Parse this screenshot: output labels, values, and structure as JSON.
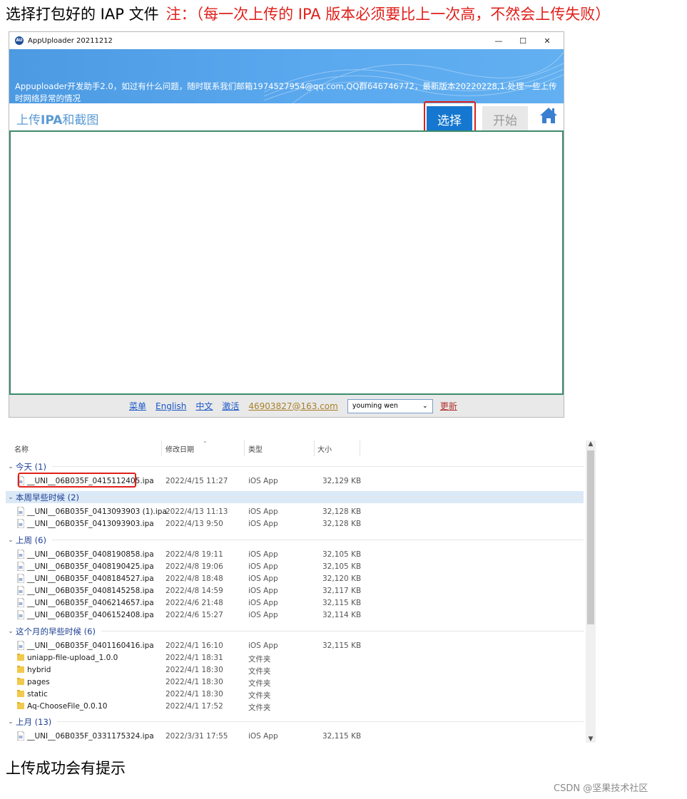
{
  "instruction": {
    "text": "选择打包好的 IAP 文件",
    "note": "注：（每一次上传的 IPA 版本必须要比上一次高，不然会上传失败）"
  },
  "window": {
    "title": "AppUploader 20211212",
    "icon_text": "AU",
    "controls": {
      "minimize": "—",
      "maximize": "☐",
      "close": "✕"
    },
    "banner_text": "Appuploader开发助手2.0，如过有什么问题，随时联系我们邮箱1974527954@qq.com,QQ群646746772，最新版本20220228,1.处理一些上传时网络异常的情况",
    "upload_title_prefix": "上传",
    "upload_title_bold": "IPA",
    "upload_title_suffix": "和截图",
    "select_button": "选择",
    "start_button": "开始",
    "footer": {
      "links": [
        "菜单",
        "English",
        "中文",
        "激活"
      ],
      "email": "46903827@163.com",
      "account_select": "youming wen",
      "update": "更新"
    }
  },
  "explorer": {
    "columns": {
      "name": "名称",
      "date": "修改日期",
      "type": "类型",
      "size": "大小"
    },
    "groups": [
      {
        "label": "今天 (1)",
        "rows": [
          {
            "name": "__UNI__06B035F_0415112405.ipa",
            "date": "2022/4/15 11:27",
            "type": "iOS App",
            "size": "32,129 KB",
            "icon": "file"
          }
        ]
      },
      {
        "label": "本周早些时候 (2)",
        "rows": [
          {
            "name": "__UNI__06B035F_0413093903 (1).ipa",
            "date": "2022/4/13 11:13",
            "type": "iOS App",
            "size": "32,128 KB",
            "icon": "file"
          },
          {
            "name": "__UNI__06B035F_0413093903.ipa",
            "date": "2022/4/13 9:50",
            "type": "iOS App",
            "size": "32,128 KB",
            "icon": "file"
          }
        ]
      },
      {
        "label": "上周 (6)",
        "rows": [
          {
            "name": "__UNI__06B035F_0408190858.ipa",
            "date": "2022/4/8 19:11",
            "type": "iOS App",
            "size": "32,105 KB",
            "icon": "file"
          },
          {
            "name": "__UNI__06B035F_0408190425.ipa",
            "date": "2022/4/8 19:06",
            "type": "iOS App",
            "size": "32,105 KB",
            "icon": "file"
          },
          {
            "name": "__UNI__06B035F_0408184527.ipa",
            "date": "2022/4/8 18:48",
            "type": "iOS App",
            "size": "32,120 KB",
            "icon": "file"
          },
          {
            "name": "__UNI__06B035F_0408145258.ipa",
            "date": "2022/4/8 14:59",
            "type": "iOS App",
            "size": "32,117 KB",
            "icon": "file"
          },
          {
            "name": "__UNI__06B035F_0406214657.ipa",
            "date": "2022/4/6 21:48",
            "type": "iOS App",
            "size": "32,115 KB",
            "icon": "file"
          },
          {
            "name": "__UNI__06B035F_0406152408.ipa",
            "date": "2022/4/6 15:27",
            "type": "iOS App",
            "size": "32,114 KB",
            "icon": "file"
          }
        ]
      },
      {
        "label": "这个月的早些时候 (6)",
        "rows": [
          {
            "name": "__UNI__06B035F_0401160416.ipa",
            "date": "2022/4/1 16:10",
            "type": "iOS App",
            "size": "32,115 KB",
            "icon": "file"
          },
          {
            "name": "uniapp-file-upload_1.0.0",
            "date": "2022/4/1 18:31",
            "type": "文件夹",
            "size": "",
            "icon": "folder"
          },
          {
            "name": "hybrid",
            "date": "2022/4/1 18:30",
            "type": "文件夹",
            "size": "",
            "icon": "folder"
          },
          {
            "name": "pages",
            "date": "2022/4/1 18:30",
            "type": "文件夹",
            "size": "",
            "icon": "folder"
          },
          {
            "name": "static",
            "date": "2022/4/1 18:30",
            "type": "文件夹",
            "size": "",
            "icon": "folder"
          },
          {
            "name": "Aq-ChooseFile_0.0.10",
            "date": "2022/4/1 17:52",
            "type": "文件夹",
            "size": "",
            "icon": "folder"
          }
        ]
      },
      {
        "label": "上月 (13)",
        "rows": [
          {
            "name": "__UNI__06B035F_0331175324.ipa",
            "date": "2022/3/31 17:55",
            "type": "iOS App",
            "size": "32,115 KB",
            "icon": "file"
          }
        ]
      }
    ]
  },
  "footer_text": "上传成功会有提示",
  "watermark": "CSDN @坚果技术社区",
  "colors": {
    "accent": "#1577cf",
    "highlight_red": "#e0201b",
    "group_blue": "#1d3f94",
    "dropzone_border": "#3d8b6a"
  }
}
